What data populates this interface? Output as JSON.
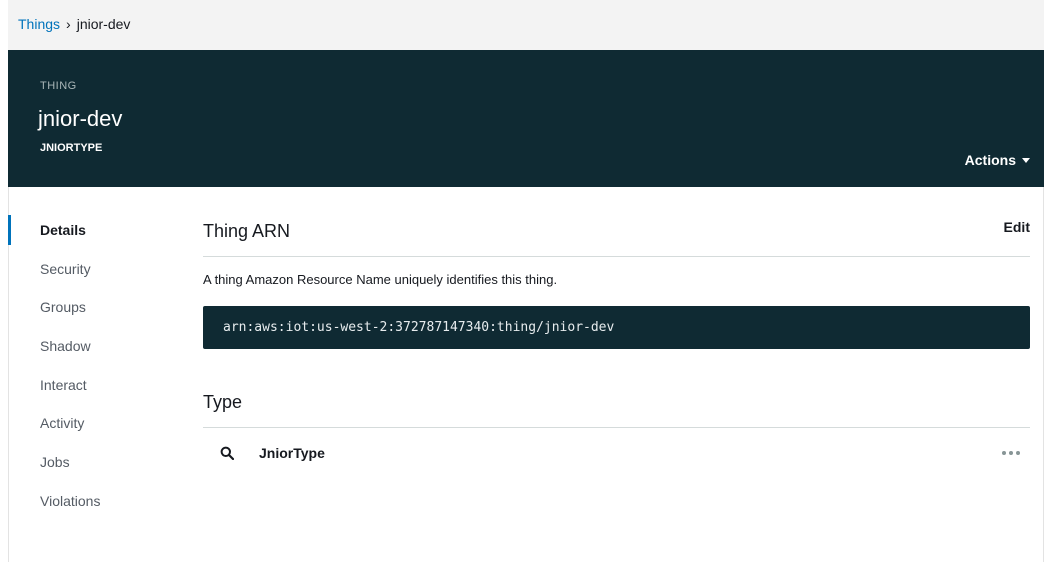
{
  "breadcrumb": {
    "parent": "Things",
    "separator": "›",
    "current": "jnior-dev"
  },
  "header": {
    "kind": "THING",
    "title": "jnior-dev",
    "type": "JNIORTYPE",
    "actions_label": "Actions"
  },
  "sidebar": {
    "items": [
      {
        "label": "Details",
        "active": true
      },
      {
        "label": "Security",
        "active": false
      },
      {
        "label": "Groups",
        "active": false
      },
      {
        "label": "Shadow",
        "active": false
      },
      {
        "label": "Interact",
        "active": false
      },
      {
        "label": "Activity",
        "active": false
      },
      {
        "label": "Jobs",
        "active": false
      },
      {
        "label": "Violations",
        "active": false
      }
    ]
  },
  "arn_section": {
    "title": "Thing ARN",
    "edit_label": "Edit",
    "description": "A thing Amazon Resource Name uniquely identifies this thing.",
    "arn": "arn:aws:iot:us-west-2:372787147340:thing/jnior-dev"
  },
  "type_section": {
    "title": "Type",
    "type_name": "JniorType",
    "search_icon": "search-icon",
    "more_icon": "more-options-icon"
  },
  "colors": {
    "header_bg": "#0f2a33",
    "accent": "#0073bb",
    "breadcrumb_link": "#0073bb"
  }
}
